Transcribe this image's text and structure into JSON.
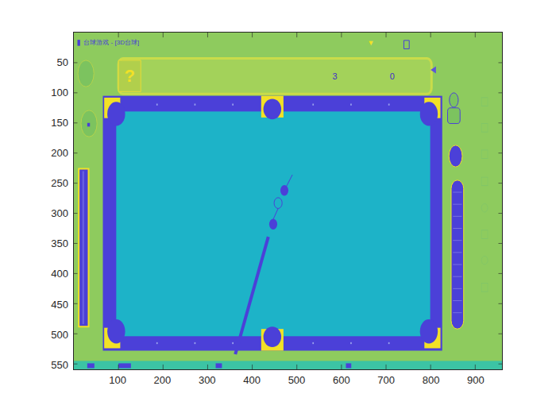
{
  "figure": {
    "x_ticks": [
      "100",
      "200",
      "300",
      "400",
      "500",
      "600",
      "700",
      "800",
      "900"
    ],
    "y_ticks": [
      "50",
      "100",
      "150",
      "200",
      "250",
      "300",
      "350",
      "400",
      "450",
      "500",
      "550"
    ]
  },
  "game": {
    "title": "台球游戏 - [3D台球]",
    "help": "?",
    "scores": [
      "3",
      "0"
    ]
  }
}
